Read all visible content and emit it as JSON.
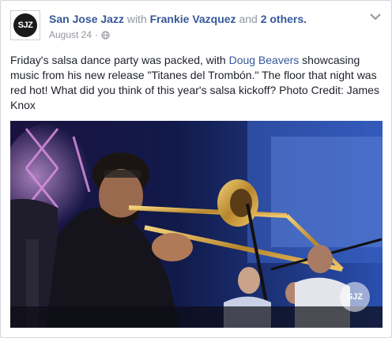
{
  "post": {
    "avatar_text": "SJZ",
    "author": "San Jose Jazz",
    "with_word": "with",
    "tagged": "Frankie Vazquez",
    "and_word": "and",
    "others": "2 others.",
    "date": "August 24",
    "date_separator": "·",
    "privacy_icon": "globe-icon",
    "menu_icon": "chevron-down-icon",
    "text_before": "Friday's salsa dance party was packed, with ",
    "mention": "Doug Beavers",
    "text_after": " showcasing music from his new release \"Titanes del Trombón.\" The floor that night was red hot! What did you think of this year's salsa kickoff? Photo Credit: James Knox",
    "photo_watermark": "SJZ"
  },
  "colors": {
    "link": "#365899",
    "meta": "#90949c",
    "text": "#1d2129"
  }
}
